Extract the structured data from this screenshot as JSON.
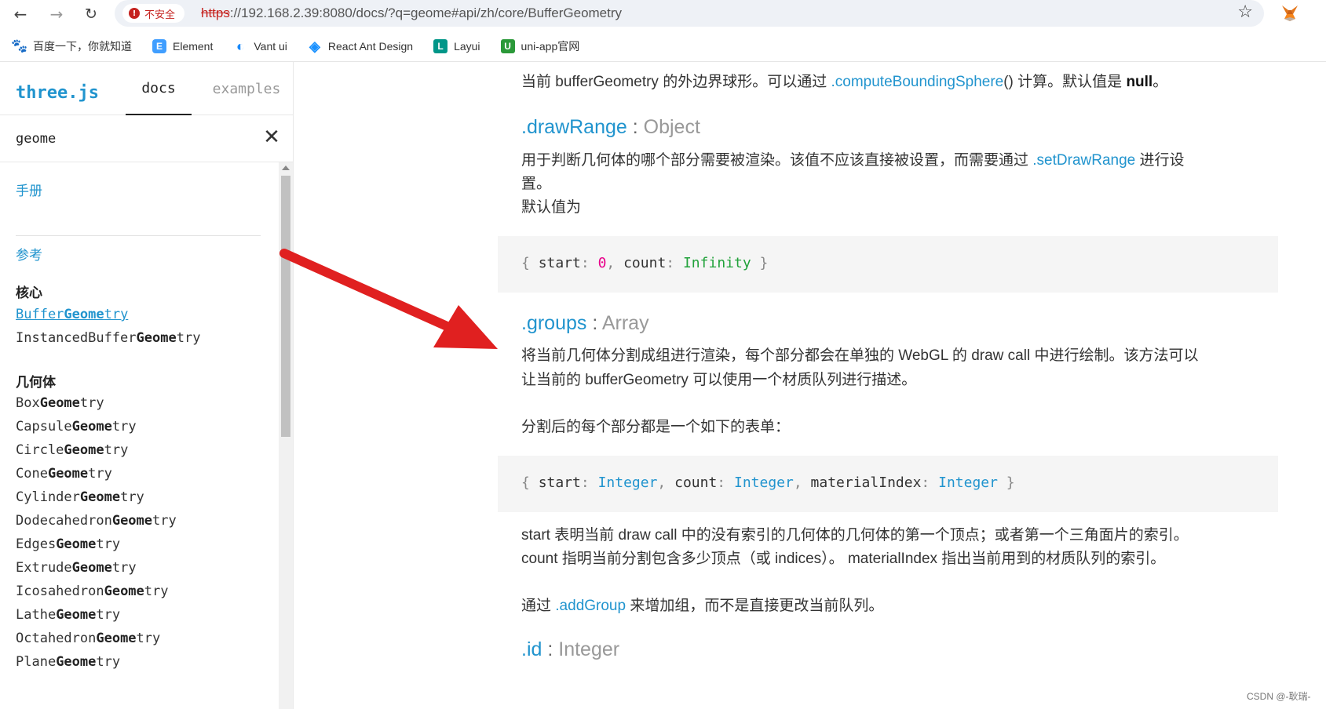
{
  "browser": {
    "security_label": "不安全",
    "url_scheme": "https",
    "url_rest": "://192.168.2.39:8080/docs/?q=geome#api/zh/core/BufferGeometry",
    "back_icon": "←",
    "forward_icon": "→",
    "reload_icon": "↻",
    "star_icon": "☆"
  },
  "bookmarks": [
    {
      "label": "百度一下，你就知道",
      "icon": "baidu-paw-icon",
      "glyph": "🐾"
    },
    {
      "label": "Element",
      "icon": "element-icon",
      "glyph": "E"
    },
    {
      "label": "Vant ui",
      "icon": "vant-icon",
      "glyph": "◐"
    },
    {
      "label": "React Ant Design",
      "icon": "ant-design-icon",
      "glyph": "◈"
    },
    {
      "label": "Layui",
      "icon": "layui-icon",
      "glyph": "L"
    },
    {
      "label": "uni-app官网",
      "icon": "uniapp-icon",
      "glyph": "U"
    }
  ],
  "sidebar": {
    "brand": "three.js",
    "tabs": {
      "docs": "docs",
      "examples": "examples"
    },
    "search": {
      "value": "geome",
      "clear_icon": "✕"
    },
    "sections": {
      "manual": "手册",
      "reference": "参考"
    },
    "categories": {
      "core": "核心",
      "geometries": "几何体"
    },
    "core_items": [
      {
        "pre": "Buffer",
        "match": "Geome",
        "post": "try",
        "selected": true
      },
      {
        "pre": "InstancedBuffer",
        "match": "Geome",
        "post": "try",
        "selected": false
      }
    ],
    "geometry_items": [
      {
        "pre": "Box",
        "match": "Geome",
        "post": "try"
      },
      {
        "pre": "Capsule",
        "match": "Geome",
        "post": "try"
      },
      {
        "pre": "Circle",
        "match": "Geome",
        "post": "try"
      },
      {
        "pre": "Cone",
        "match": "Geome",
        "post": "try"
      },
      {
        "pre": "Cylinder",
        "match": "Geome",
        "post": "try"
      },
      {
        "pre": "Dodecahedron",
        "match": "Geome",
        "post": "try"
      },
      {
        "pre": "Edges",
        "match": "Geome",
        "post": "try"
      },
      {
        "pre": "Extrude",
        "match": "Geome",
        "post": "try"
      },
      {
        "pre": "Icosahedron",
        "match": "Geome",
        "post": "try"
      },
      {
        "pre": "Lathe",
        "match": "Geome",
        "post": "try"
      },
      {
        "pre": "Octahedron",
        "match": "Geome",
        "post": "try"
      },
      {
        "pre": "Plane",
        "match": "Geome",
        "post": "try"
      }
    ]
  },
  "content": {
    "bounding_sphere": {
      "text_before": "当前 bufferGeometry 的外边界球形。可以通过 ",
      "link": ".computeBoundingSphere",
      "text_mid": "() 计算。默认值是 ",
      "bold": "null",
      "text_after": "。"
    },
    "draw_range": {
      "name": ".drawRange",
      "separator": " : ",
      "type": "Object",
      "desc_line1_before": "用于判断几何体的哪个部分需要被渲染。该值不应该直接被设置，而需要通过 ",
      "desc_line1_link": ".setDrawRange",
      "desc_line1_after": " 进行设",
      "desc_line2": "置。",
      "default_label": "默认值为",
      "code": {
        "open": "{ ",
        "key1": "start",
        "sep": ": ",
        "val1": "0",
        "comma": ", ",
        "key2": "count",
        "val2": "Infinity",
        "close": " }"
      }
    },
    "groups": {
      "name": ".groups",
      "separator": " : ",
      "type": "Array",
      "desc_line1": "将当前几何体分割成组进行渲染，每个部分都会在单独的 WebGL 的 draw call 中进行绘制。该方法可以",
      "desc_line2": "让当前的 bufferGeometry 可以使用一个材质队列进行描述。",
      "form_label": "分割后的每个部分都是一个如下的表单：",
      "code": {
        "open": "{ ",
        "key1": "start",
        "sep": ": ",
        "type1": "Integer",
        "comma": ", ",
        "key2": "count",
        "type2": "Integer",
        "key3": "materialIndex",
        "type3": "Integer",
        "close": " }"
      },
      "explain_line1": "start 表明当前 draw call 中的没有索引的几何体的几何体的第一个顶点；或者第一个三角面片的索引。",
      "explain_line2": "count 指明当前分割包含多少顶点（或 indices）。 materialIndex 指出当前用到的材质队列的索引。",
      "add_before": "通过 ",
      "add_link": ".addGroup",
      "add_after": " 来增加组，而不是直接更改当前队列。"
    },
    "id": {
      "name": ".id",
      "separator": " : ",
      "type": "Integer"
    }
  },
  "watermark": "CSDN @-耿瑞-",
  "colors": {
    "link": "#2194ce",
    "arrow": "#e02020",
    "code_bg": "#f5f5f5"
  }
}
